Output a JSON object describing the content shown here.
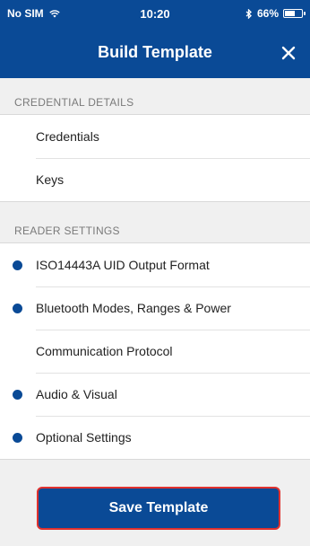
{
  "status_bar": {
    "carrier": "No SIM",
    "time": "10:20",
    "battery_percent": "66%",
    "battery_level": 0.66,
    "icons": [
      "wifi-icon",
      "bluetooth-icon",
      "battery-icon"
    ]
  },
  "nav": {
    "title": "Build Template",
    "close_icon": "close-icon"
  },
  "sections": {
    "credential_details": {
      "header": "CREDENTIAL DETAILS",
      "items": [
        {
          "label": "Credentials",
          "has_dot": false
        },
        {
          "label": "Keys",
          "has_dot": false
        }
      ]
    },
    "reader_settings": {
      "header": "READER SETTINGS",
      "items": [
        {
          "label": "ISO14443A UID Output Format",
          "has_dot": true
        },
        {
          "label": "Bluetooth Modes, Ranges & Power",
          "has_dot": true
        },
        {
          "label": "Communication Protocol",
          "has_dot": false
        },
        {
          "label": "Audio & Visual",
          "has_dot": true
        },
        {
          "label": "Optional Settings",
          "has_dot": true
        }
      ]
    }
  },
  "footer": {
    "save_label": "Save Template"
  },
  "colors": {
    "brand": "#0a4a96",
    "button_border": "#e0312e",
    "background": "#f0f0f0"
  }
}
